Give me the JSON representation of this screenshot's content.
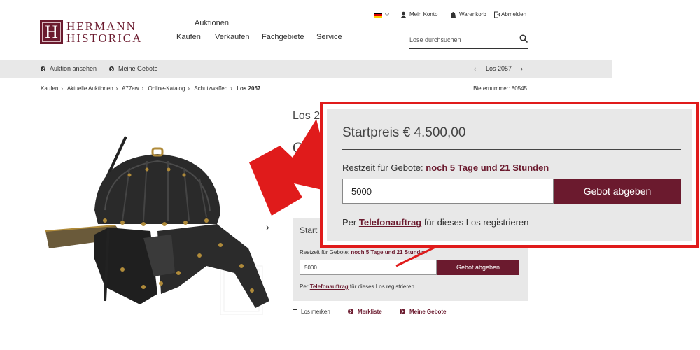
{
  "brand": {
    "letter": "H",
    "line1": "HERMANN",
    "line2": "HISTORICA",
    "color": "#6b1a2e"
  },
  "nav": {
    "auktionen": "Auktionen",
    "items": [
      "Kaufen",
      "Verkaufen",
      "Fachgebiete",
      "Service"
    ]
  },
  "util": {
    "konto": "Mein Konto",
    "warenkorb": "Warenkorb",
    "abmelden": "Abmelden"
  },
  "search": {
    "placeholder": "Lose durchsuchen"
  },
  "subbar": {
    "auktion_ansehen": "Auktion ansehen",
    "meine_gebote": "Meine Gebote",
    "los": "Los 2057"
  },
  "breadcrumb": [
    "Kaufen",
    "Aktuelle Auktionen",
    "A77aw",
    "Online-Katalog",
    "Schutzwaffen",
    "Los 2057"
  ],
  "bieternummer": "Bieternummer: 80545",
  "lot": {
    "title_partial": "Los 2",
    "object_partial": "O"
  },
  "bid": {
    "startpreis": "Startpreis € 4.500,00",
    "startpreis_partial": "Start",
    "restzeit_label": "Restzeit für Gebote:",
    "restzeit_value": "noch 5 Tage und 21 Stunden",
    "input_value": "5000",
    "button": "Gebot abgeben",
    "tel_pre": "Per",
    "tel_link": "Telefonauftrag",
    "tel_post": "für dieses Los registrieren"
  },
  "actions": {
    "merken": "Los merken",
    "merkliste": "Merkliste",
    "meine_gebote": "Meine Gebote"
  },
  "colors": {
    "accent": "#6b1a2e",
    "highlight": "#e01b1b",
    "bar": "#e8e8e8"
  }
}
